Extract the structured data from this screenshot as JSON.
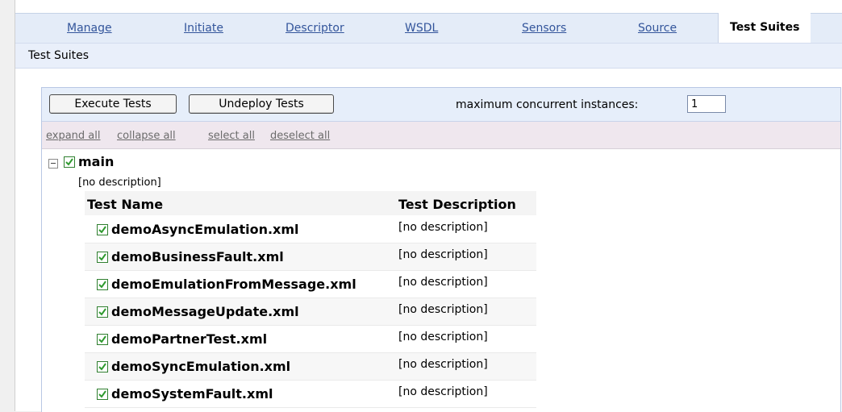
{
  "tabs": [
    {
      "label": "Manage"
    },
    {
      "label": "Initiate"
    },
    {
      "label": "Descriptor"
    },
    {
      "label": "WSDL"
    },
    {
      "label": "Sensors"
    },
    {
      "label": "Source"
    },
    {
      "label": "Test Suites"
    }
  ],
  "subtitle": "Test Suites",
  "toolbar": {
    "execute_label": "Execute Tests",
    "undeploy_label": "Undeploy Tests",
    "max_label": "maximum concurrent instances:",
    "max_value": "1"
  },
  "links": {
    "expand_all": "expand all",
    "collapse_all": "collapse all",
    "select_all": "select all",
    "deselect_all": "deselect all"
  },
  "suite": {
    "name": "main",
    "description": "[no description]",
    "checked": true
  },
  "table": {
    "col_name": "Test Name",
    "col_desc": "Test Description",
    "rows": [
      {
        "name": "demoAsyncEmulation.xml",
        "desc": "[no description]",
        "checked": true
      },
      {
        "name": "demoBusinessFault.xml",
        "desc": "[no description]",
        "checked": true
      },
      {
        "name": "demoEmulationFromMessage.xml",
        "desc": "[no description]",
        "checked": true
      },
      {
        "name": "demoMessageUpdate.xml",
        "desc": "[no description]",
        "checked": true
      },
      {
        "name": "demoPartnerTest.xml",
        "desc": "[no description]",
        "checked": true
      },
      {
        "name": "demoSyncEmulation.xml",
        "desc": "[no description]",
        "checked": true
      },
      {
        "name": "demoSystemFault.xml",
        "desc": "[no description]",
        "checked": true
      }
    ]
  },
  "colors": {
    "tab_link": "#33559b",
    "check_green": "#2f9a2f",
    "toolbar_bg": "#e6eefa",
    "links_bg": "#efe7ee"
  }
}
